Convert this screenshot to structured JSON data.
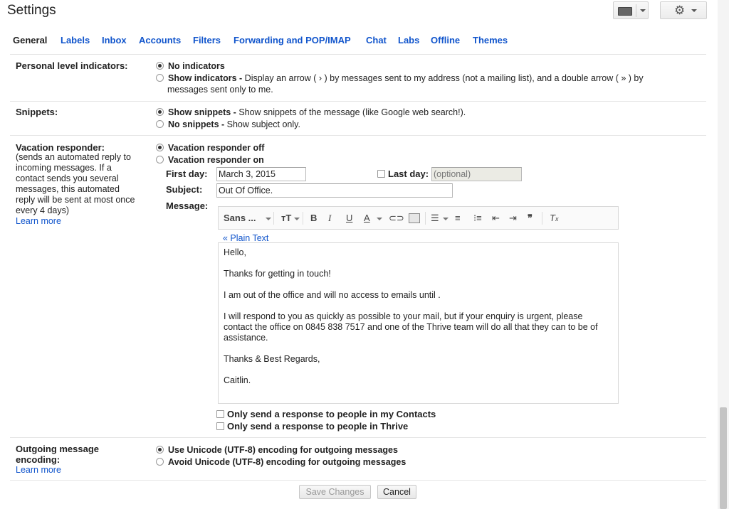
{
  "page": {
    "title": "Settings"
  },
  "tabs": [
    "General",
    "Labels",
    "Inbox",
    "Accounts",
    "Filters",
    "Forwarding and POP/IMAP",
    "Chat",
    "Labs",
    "Offline",
    "Themes"
  ],
  "indicators": {
    "label": "Personal level indicators:",
    "opt1_title": "No indicators",
    "opt2_title": "Show indicators -",
    "opt2_desc_line1": " Display an arrow ( › ) by messages sent to my address (not a mailing list), and a double arrow ( » ) by",
    "opt2_desc_line2": "messages sent only to me.",
    "selected": "No indicators"
  },
  "snippets": {
    "label": "Snippets:",
    "opt1_title": "Show snippets -",
    "opt1_desc": " Show snippets of the message (like Google web search!).",
    "opt2_title": "No snippets -",
    "opt2_desc": " Show subject only.",
    "selected": "Show snippets"
  },
  "vacation": {
    "label": "Vacation responder:",
    "note_lines": [
      "(sends an automated reply to",
      "incoming messages. If a",
      "contact sends you several",
      "messages, this automated",
      "reply will be sent at most once",
      "every 4 days)"
    ],
    "learn_more": "Learn more",
    "off_label": "Vacation responder off",
    "on_label": "Vacation responder on",
    "selected": "Vacation responder off",
    "first_day_label": "First day:",
    "first_day_value": "March 3, 2015",
    "last_day_label": "Last day:",
    "last_day_placeholder": "(optional)",
    "subject_label": "Subject:",
    "subject_value": "Out Of Office.",
    "message_label": "Message:",
    "font_label": "Sans ...",
    "plain_text_link": "« Plain Text",
    "message_lines": [
      "Hello,",
      "Thanks for getting in touch!",
      "I am out of the office and will no access to emails until .",
      "I will respond to you as quickly as possible to your mail, but if your enquiry is urgent, please contact the office on 0845 838 7517 and one of the Thrive team will do all that they can to be of assistance.",
      "Thanks & Best Regards,",
      "Caitlin."
    ],
    "contacts_only": "Only send a response to people in my Contacts",
    "thrive_only": "Only send a response to people in Thrive"
  },
  "encoding": {
    "label_line1": "Outgoing message",
    "label_line2": "encoding:",
    "learn_more": "Learn more",
    "opt1": "Use Unicode (UTF-8) encoding for outgoing messages",
    "opt2": "Avoid Unicode (UTF-8) encoding for outgoing messages",
    "selected": "Use Unicode (UTF-8) encoding for outgoing messages"
  },
  "actions": {
    "save": "Save Changes",
    "cancel": "Cancel"
  }
}
